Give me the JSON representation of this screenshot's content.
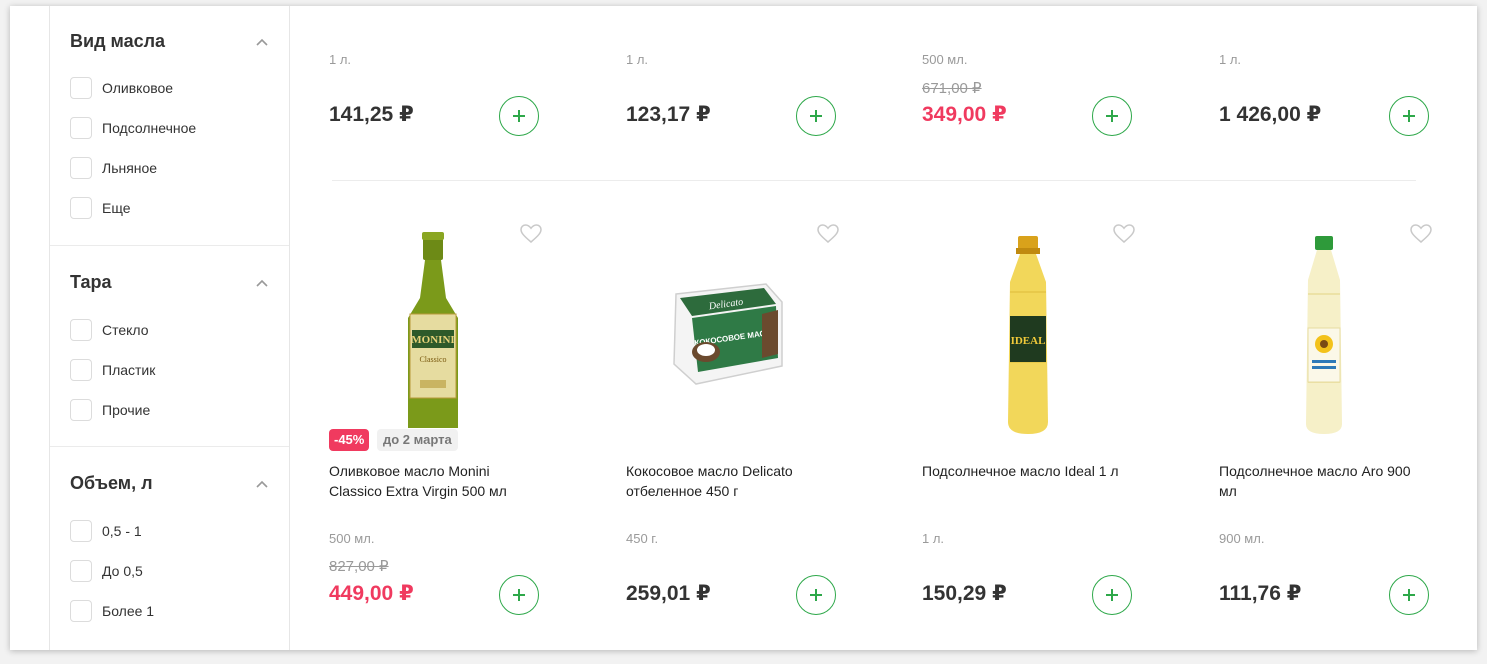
{
  "filters": [
    {
      "title": "Вид масла",
      "options": [
        "Оливковое",
        "Подсолнечное",
        "Льняное",
        "Еще"
      ]
    },
    {
      "title": "Тара",
      "options": [
        "Стекло",
        "Пластик",
        "Прочие"
      ]
    },
    {
      "title": "Объем, л",
      "options": [
        "0,5 - 1",
        "До 0,5",
        "Более 1"
      ]
    }
  ],
  "top_row": [
    {
      "unit": "1 л.",
      "old_price": "",
      "price": "141,25 ₽",
      "sale": false
    },
    {
      "unit": "1 л.",
      "old_price": "",
      "price": "123,17 ₽",
      "sale": false
    },
    {
      "unit": "500 мл.",
      "old_price": "671,00 ₽",
      "price": "349,00 ₽",
      "sale": true
    },
    {
      "unit": "1 л.",
      "old_price": "",
      "price": "1 426,00 ₽",
      "sale": false
    }
  ],
  "products": [
    {
      "name": "Оливковое масло Monini Classico Extra Virgin 500 мл",
      "unit": "500 мл.",
      "old_price": "827,00 ₽",
      "price": "449,00 ₽",
      "sale": true,
      "discount": "-45%",
      "promo_until": "до 2 марта",
      "label_text": "MONINI",
      "label_sub": "Classico"
    },
    {
      "name": "Кокосовое масло Delicato отбеленное 450 г",
      "unit": "450 г.",
      "old_price": "",
      "price": "259,01 ₽",
      "sale": false,
      "label_text": "Delicato",
      "label_sub": "КОКОСОВОЕ МАСЛО"
    },
    {
      "name": "Подсолнечное масло Ideal 1 л",
      "unit": "1 л.",
      "old_price": "",
      "price": "150,29 ₽",
      "sale": false,
      "label_text": "IDEAL"
    },
    {
      "name": "Подсолнечное масло Aro 900 мл",
      "unit": "900 мл.",
      "old_price": "",
      "price": "111,76 ₽",
      "sale": false
    }
  ],
  "colors": {
    "accent_green": "#2ea84a",
    "sale_pink": "#f03a5f"
  },
  "icons": {
    "add": "plus-icon",
    "favorite": "heart-icon",
    "collapse": "chevron-up-icon"
  }
}
